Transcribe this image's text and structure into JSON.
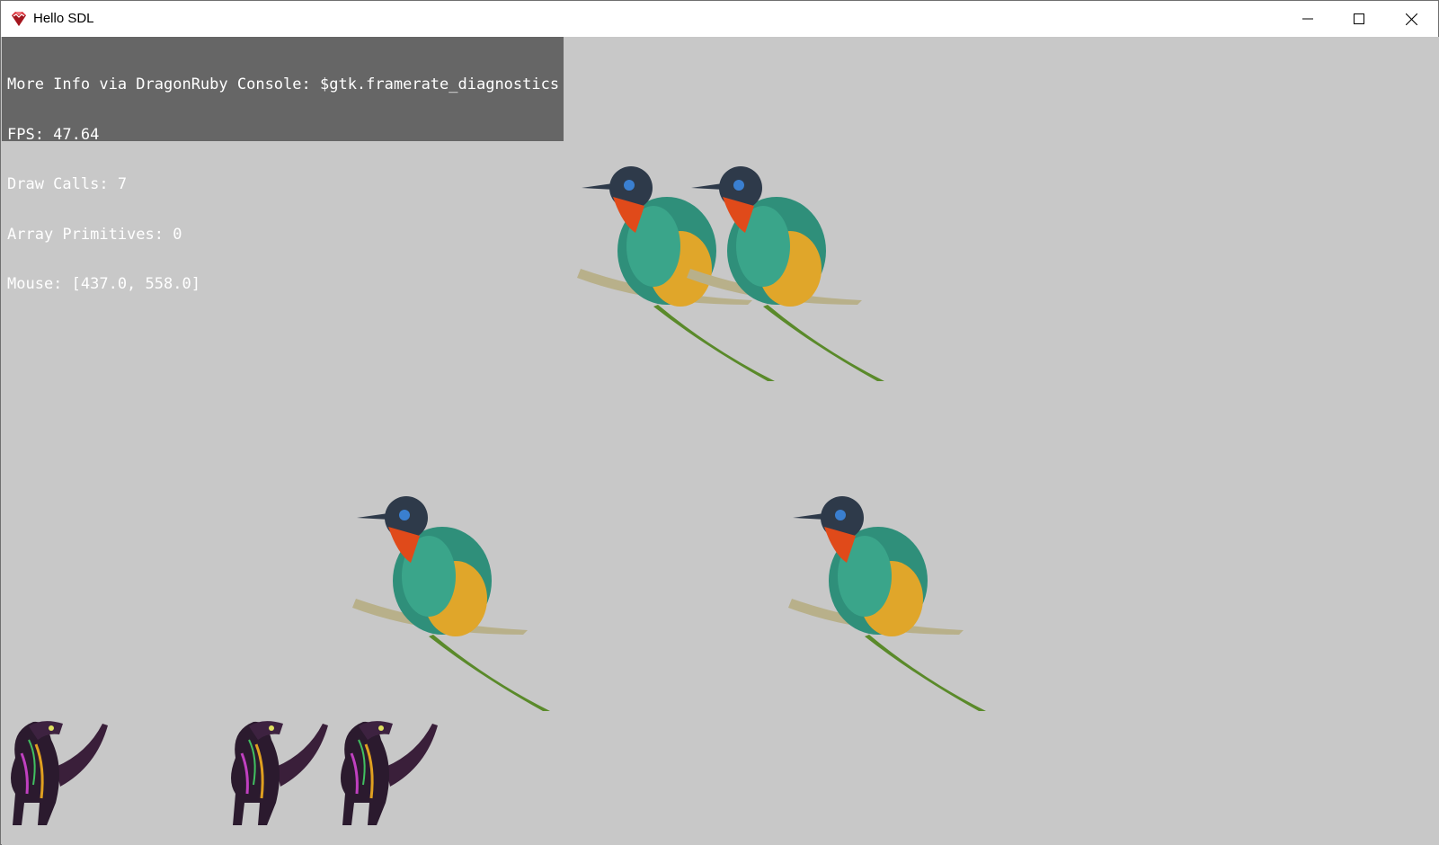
{
  "window": {
    "title": "Hello SDL",
    "app_icon": "dragonruby-gem-icon",
    "controls": [
      "minimize-icon",
      "maximize-icon",
      "close-icon"
    ]
  },
  "diagnostics": {
    "lines": [
      "More Info via DragonRuby Console: $gtk.framerate_diagnostics",
      "FPS: 47.64",
      "Draw Calls: 7",
      "Array Primitives: 0",
      "Mouse: [437.0, 558.0]"
    ]
  },
  "scene": {
    "background_color": "#c8c8c8",
    "sprites": [
      {
        "kind": "bird",
        "name": "bird-sprite-1"
      },
      {
        "kind": "bird",
        "name": "bird-sprite-2"
      },
      {
        "kind": "bird",
        "name": "bird-sprite-3"
      },
      {
        "kind": "bird",
        "name": "bird-sprite-4"
      },
      {
        "kind": "dinosaur",
        "name": "dinosaur-sprite-1"
      },
      {
        "kind": "dinosaur",
        "name": "dinosaur-sprite-2"
      },
      {
        "kind": "dinosaur",
        "name": "dinosaur-sprite-3"
      }
    ]
  }
}
